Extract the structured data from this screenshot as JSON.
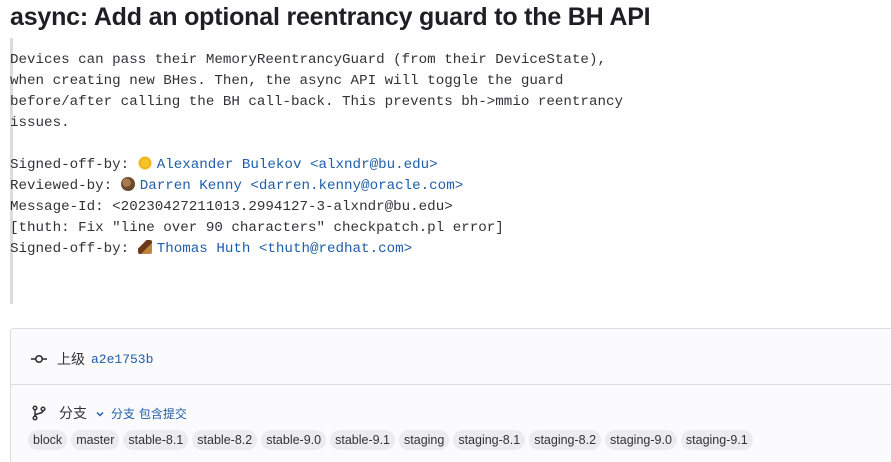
{
  "commit": {
    "title": "async: Add an optional reentrancy guard to the BH API",
    "message": {
      "body_lines": [
        "Devices can pass their MemoryReentrancyGuard (from their DeviceState),",
        "when creating new BHes. Then, the async API will toggle the guard",
        "before/after calling the BH call-back. This prevents bh->mmio reentrancy",
        "issues."
      ],
      "trailers": [
        {
          "label": "Signed-off-by: ",
          "avatar_icon": "sun-avatar-icon",
          "name": "Alexander Bulekov",
          "email": " <alxndr@bu.edu>"
        },
        {
          "label": "Reviewed-by: ",
          "avatar_icon": "user-photo-avatar-icon",
          "name": "Darren Kenny",
          "email": " <darren.kenny@oracle.com>"
        },
        {
          "label": "Message-Id: <20230427211013.2994127-3-alxndr@bu.edu>"
        },
        {
          "label": "[thuth: Fix \"line over 90 characters\" checkpatch.pl error]"
        },
        {
          "label": "Signed-off-by: ",
          "avatar_icon": "user-photo-avatar-icon",
          "name": "Thomas Huth",
          "email": " <thuth@redhat.com>"
        }
      ]
    }
  },
  "parent": {
    "label": "上级",
    "sha": "a2e1753b",
    "icon": "commit-icon"
  },
  "branches": {
    "label": "分支",
    "icon": "branch-icon",
    "toggle_label": "分支 包含提交",
    "toggle_icon": "chevron-down-icon",
    "items": [
      "block",
      "master",
      "stable-8.1",
      "stable-8.2",
      "stable-9.0",
      "stable-9.1",
      "staging",
      "staging-8.1",
      "staging-8.2",
      "staging-9.0",
      "staging-9.1"
    ]
  },
  "colors": {
    "link": "#1f5ea8",
    "badge_bg": "#ececef",
    "border": "#dcdcde",
    "text": "#333238"
  }
}
